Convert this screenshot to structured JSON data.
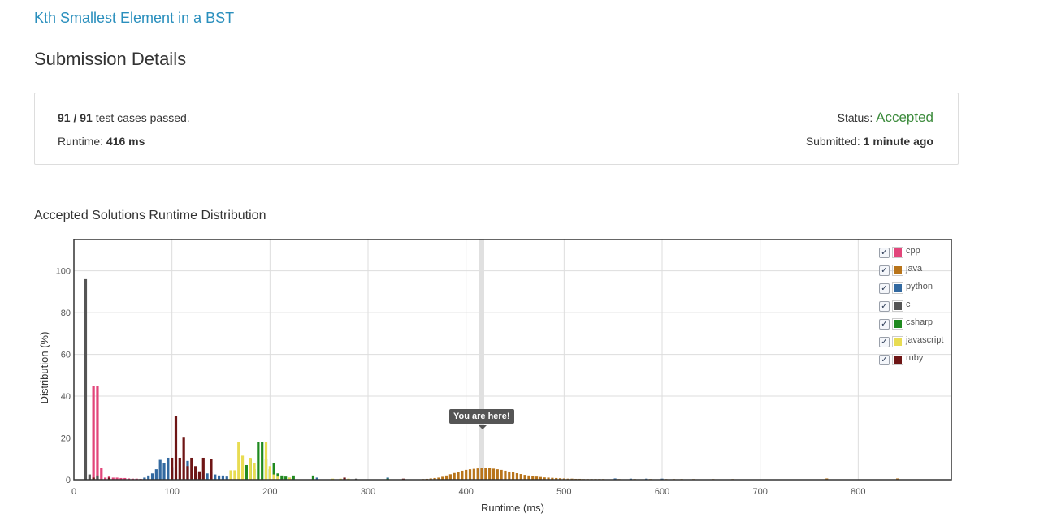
{
  "problem": {
    "title": "Kth Smallest Element in a BST"
  },
  "page": {
    "title": "Submission Details"
  },
  "summary": {
    "passed": "91",
    "separator": "/",
    "total": "91",
    "passed_text": "test cases passed.",
    "runtime_label": "Runtime:",
    "runtime_value": "416 ms",
    "status_label": "Status:",
    "status_value": "Accepted",
    "status_color": "#3c8b3c",
    "submitted_label": "Submitted:",
    "submitted_value": "1 minute ago"
  },
  "chart_section": {
    "title": "Accepted Solutions Runtime Distribution"
  },
  "colors": {
    "link": "#2a8fbd",
    "accent_green": "#3c8b3c",
    "tooltip_bg": "#555555"
  },
  "legend_check_glyph": "✓",
  "tooltip": {
    "text": "You are here!"
  },
  "chart_data": {
    "type": "bar",
    "title": "Accepted Solutions Runtime Distribution",
    "xlabel": "Runtime (ms)",
    "ylabel": "Distribution (%)",
    "xlim": [
      0,
      895
    ],
    "ylim": [
      0,
      115
    ],
    "xticks": [
      "0",
      "100",
      "200",
      "300",
      "400",
      "500",
      "600",
      "700",
      "800"
    ],
    "yticks": [
      "0",
      "20",
      "40",
      "60",
      "80",
      "100"
    ],
    "grid": true,
    "legend_position": "top-right",
    "marker": {
      "label": "You are here!",
      "x": 416
    },
    "series": [
      {
        "name": "cpp",
        "color": "#e2457a",
        "checked": true,
        "x": [
          20,
          24,
          28,
          32,
          36,
          40,
          44,
          48,
          52,
          56,
          60,
          64,
          68,
          72
        ],
        "values": [
          45,
          45,
          5.5,
          1,
          1.5,
          1,
          1,
          0.8,
          0.8,
          0.6,
          0.5,
          0.5,
          0.4,
          0.3
        ]
      },
      {
        "name": "java",
        "color": "#b8741a",
        "checked": true,
        "x": [
          356,
          360,
          364,
          368,
          372,
          376,
          380,
          384,
          388,
          392,
          396,
          400,
          404,
          408,
          412,
          416,
          420,
          424,
          428,
          432,
          436,
          440,
          444,
          448,
          452,
          456,
          460,
          464,
          468,
          472,
          476,
          480,
          484,
          488,
          492,
          496,
          500,
          504,
          508,
          512,
          516,
          520,
          524,
          528,
          532,
          536,
          540,
          556,
          572,
          588,
          604,
          612,
          620,
          632,
          652,
          672,
          768,
          840
        ],
        "values": [
          0.3,
          0.4,
          0.6,
          0.8,
          1,
          1.4,
          2,
          2.6,
          3.2,
          3.8,
          4.3,
          4.7,
          5,
          5.2,
          5.4,
          5.6,
          5.7,
          5.5,
          5.3,
          5,
          4.7,
          4.3,
          3.9,
          3.5,
          3.1,
          2.7,
          2.3,
          2,
          1.7,
          1.5,
          1.3,
          1.1,
          1,
          0.9,
          0.8,
          0.7,
          0.6,
          0.5,
          0.5,
          0.4,
          0.4,
          0.3,
          0.3,
          0.3,
          0.3,
          0.3,
          0.3,
          0.3,
          0.3,
          0.3,
          0.3,
          0.3,
          0.3,
          0.3,
          0.3,
          0.3,
          0.6,
          0.6
        ]
      },
      {
        "name": "python",
        "color": "#3269a0",
        "checked": true,
        "x": [
          72,
          76,
          80,
          84,
          88,
          92,
          96,
          100,
          116,
          124,
          136,
          140,
          144,
          148,
          152,
          156,
          248,
          320,
          552,
          568,
          584,
          600
        ],
        "values": [
          1,
          2,
          3,
          5,
          9.5,
          8,
          10.5,
          6,
          9,
          3,
          3,
          3.5,
          2.5,
          2,
          2,
          1.5,
          1,
          1,
          0.6,
          0.5,
          0.5,
          0.5
        ]
      },
      {
        "name": "c",
        "color": "#555555",
        "checked": true,
        "x": [
          12,
          16,
          24,
          128,
          288
        ],
        "values": [
          96,
          2.5,
          2,
          0.5,
          0.5
        ]
      },
      {
        "name": "csharp",
        "color": "#1f8a1f",
        "checked": true,
        "x": [
          176,
          180,
          184,
          188,
          192,
          196,
          200,
          204,
          208,
          212,
          216,
          220,
          224,
          244,
          320
        ],
        "values": [
          7,
          10,
          5,
          18,
          18,
          10,
          5,
          8,
          3,
          2,
          1.5,
          1,
          2,
          2,
          0.5
        ]
      },
      {
        "name": "javascript",
        "color": "#e8dc52",
        "checked": true,
        "x": [
          160,
          164,
          168,
          172,
          180,
          184,
          196,
          200,
          204,
          208,
          220,
          264,
          272,
          280
        ],
        "values": [
          4.5,
          4.5,
          18,
          11.5,
          10.5,
          8,
          18,
          6.5,
          2.5,
          1.5,
          1,
          0.5,
          0.5,
          0.5
        ]
      },
      {
        "name": "ruby",
        "color": "#6e1515",
        "checked": true,
        "x": [
          20,
          36,
          100,
          104,
          108,
          112,
          116,
          120,
          124,
          128,
          132,
          140,
          276,
          336
        ],
        "values": [
          1,
          1,
          10.5,
          30.5,
          10.5,
          20.5,
          6.5,
          10.5,
          6.5,
          4,
          10.5,
          10,
          1,
          0.5
        ]
      }
    ]
  }
}
